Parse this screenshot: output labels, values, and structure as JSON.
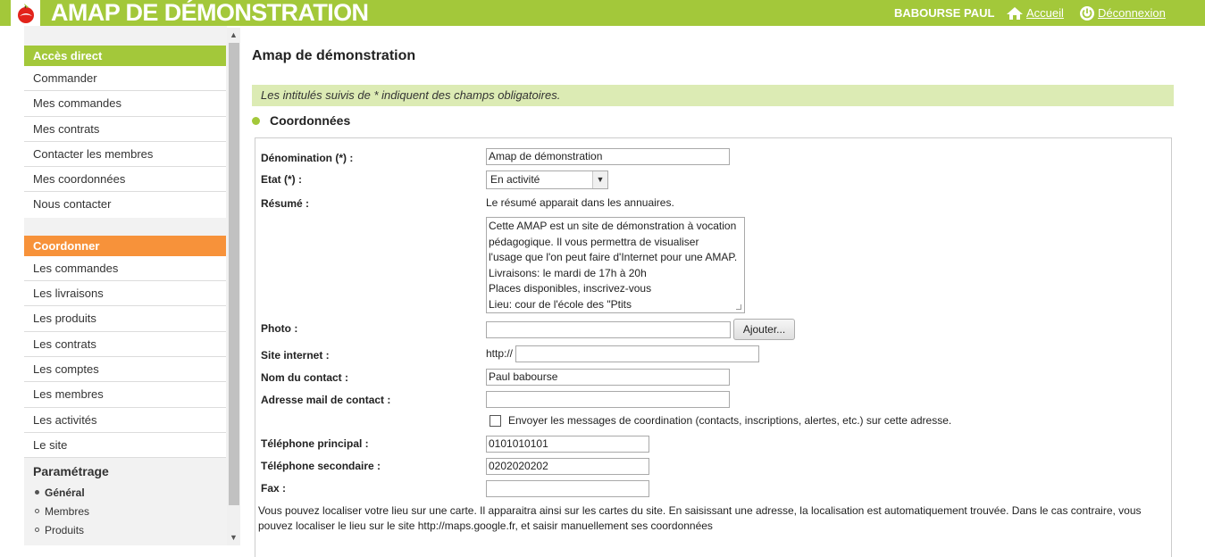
{
  "header": {
    "title": "AMAP DE DÉMONSTRATION",
    "user": "BABOURSE PAUL",
    "home_label": "Accueil",
    "logout_label": "Déconnexion"
  },
  "sidebar": {
    "acces_title": "Accès direct",
    "acces_items": [
      "Commander",
      "Mes commandes",
      "Mes contrats",
      "Contacter les membres",
      "Mes coordonnées",
      "Nous contacter"
    ],
    "coord_title": "Coordonner",
    "coord_items": [
      "Les commandes",
      "Les livraisons",
      "Les produits",
      "Les contrats",
      "Les comptes",
      "Les membres",
      "Les activités",
      "Le site"
    ],
    "param_title": "Paramétrage",
    "param_items": [
      "Général",
      "Membres",
      "Produits"
    ],
    "param_active": "Général"
  },
  "main": {
    "page_title": "Amap de démonstration",
    "notice": "Les intitulés suivis de * indiquent des champs obligatoires.",
    "section_title": "Coordonnées"
  },
  "form": {
    "denomination_label": "Dénomination (*) :",
    "denomination_value": "Amap de démonstration",
    "etat_label": "Etat (*) :",
    "etat_value": "En activité",
    "resume_label": "Résumé :",
    "resume_help": "Le résumé apparait dans les annuaires.",
    "resume_value": "Cette AMAP est un site de démonstration à vocation\npédagogique. Il vous permettra de visualiser\nl'usage que l'on peut faire d'Internet pour une AMAP.\nLivraisons: le mardi de 17h à 20h\nPlaces disponibles, inscrivez-vous\nLieu: cour de l'école des \"Ptits",
    "photo_label": "Photo :",
    "photo_value": "",
    "add_button": "Ajouter...",
    "site_label": "Site internet :",
    "site_prefix": "http://",
    "site_value": "",
    "contact_label": "Nom du contact :",
    "contact_value": "Paul babourse",
    "email_label": "Adresse mail de contact :",
    "email_value": "",
    "coord_checkbox_label": "Envoyer les messages de coordination (contacts, inscriptions, alertes, etc.) sur cette adresse.",
    "coord_checkbox_checked": false,
    "tel1_label": "Téléphone principal :",
    "tel1_value": "0101010101",
    "tel2_label": "Téléphone secondaire :",
    "tel2_value": "0202020202",
    "fax_label": "Fax :",
    "fax_value": "",
    "map_text": "Vous pouvez localiser votre lieu sur une carte. Il apparaitra ainsi sur les cartes du site. En saisissant une adresse, la localisation est automatiquement trouvée. Dans le cas contraire, vous pouvez localiser le lieu sur le site http://maps.google.fr, et saisir manuellement ses coordonnées"
  },
  "colors": {
    "brand_green": "#a3c83a",
    "orange": "#f7923a",
    "notice_bg": "#dcebb4"
  },
  "icons": [
    "logo-icon",
    "home-icon",
    "power-icon",
    "chevron-up-icon",
    "chevron-down-icon",
    "dropdown-arrow-icon"
  ]
}
